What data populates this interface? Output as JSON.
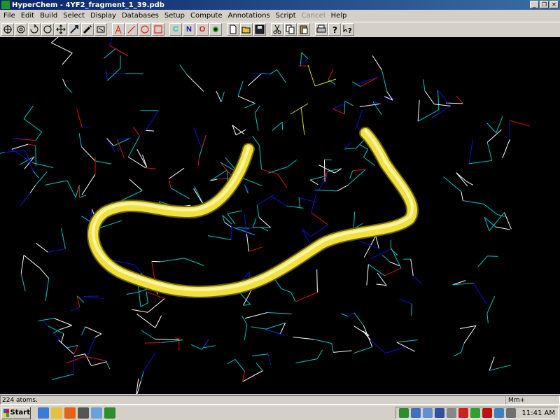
{
  "window": {
    "title": "HyperChem - 4YF2_fragment_1_39.pdb"
  },
  "menu": [
    {
      "label": "File",
      "enabled": true
    },
    {
      "label": "Edit",
      "enabled": true
    },
    {
      "label": "Build",
      "enabled": true
    },
    {
      "label": "Select",
      "enabled": true
    },
    {
      "label": "Display",
      "enabled": true
    },
    {
      "label": "Databases",
      "enabled": true
    },
    {
      "label": "Setup",
      "enabled": true
    },
    {
      "label": "Compute",
      "enabled": true
    },
    {
      "label": "Annotations",
      "enabled": true
    },
    {
      "label": "Script",
      "enabled": true
    },
    {
      "label": "Cancel",
      "enabled": false
    },
    {
      "label": "Help",
      "enabled": true
    }
  ],
  "toolbar": {
    "group1": [
      "draw-tool-icon",
      "select-tool-icon",
      "rotate-xy-icon",
      "rotate-z-icon",
      "translate-xy-icon",
      "translate-z-icon",
      "zoom-icon",
      "clip-icon"
    ],
    "group2": [
      "text-annotation-icon",
      "line-annotation-icon",
      "ellipse-annotation-icon",
      "rectangle-annotation-icon"
    ],
    "group3": [
      "carbon-label",
      "nitrogen-label",
      "oxygen-label",
      "element-table-icon"
    ],
    "group4": [
      "new-file-icon",
      "open-file-icon",
      "save-file-icon"
    ],
    "group5": [
      "cut-icon",
      "copy-icon",
      "paste-icon"
    ],
    "group6": [
      "print-icon",
      "help-icon",
      "context-help-icon"
    ],
    "letters": {
      "carbon": "C",
      "nitrogen": "N",
      "oxygen": "O"
    }
  },
  "status": {
    "message": "224 atoms.",
    "memory": "Mm+"
  },
  "taskbar": {
    "start_label": "Start",
    "clock": "11:41 AM"
  },
  "colors": {
    "carbon_bond": "#00c8c8",
    "nitrogen_bond": "#1010d0",
    "oxygen_bond": "#e01010",
    "hydrogen_bond": "#ffffff",
    "sulfur_bond": "#e0e000",
    "ribbon": "#f0e040"
  }
}
